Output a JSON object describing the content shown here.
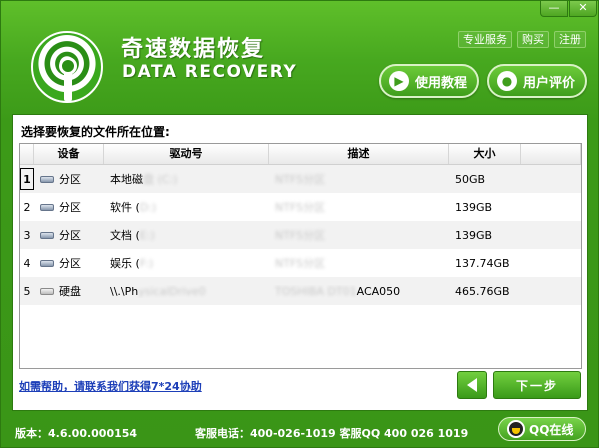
{
  "window": {
    "minimize_glyph": "—",
    "close_glyph": "✕"
  },
  "header": {
    "title_cn": "奇速数据恢复",
    "title_en": "DATA RECOVERY",
    "links": [
      "专业服务",
      "购买",
      "注册"
    ],
    "tutorial_label": "使用教程",
    "review_label": "用户评价",
    "tutorial_icon": "play-icon",
    "review_icon": "user-icon"
  },
  "panel": {
    "title": "选择要恢复的文件所在位置:",
    "columns": [
      "",
      "设备",
      "驱动号",
      "描述",
      "大小",
      ""
    ],
    "rows": [
      {
        "idx": "1",
        "device": "分区",
        "drive": "本地磁",
        "drive_hidden": "盘 (C:)",
        "desc": "",
        "desc_hidden": "NTFS分区",
        "size": "50GB",
        "icon": "partition-icon"
      },
      {
        "idx": "2",
        "device": "分区",
        "drive": "软件 (",
        "drive_hidden": "D:)",
        "desc": "",
        "desc_hidden": "NTFS分区",
        "size": "139GB",
        "icon": "partition-icon"
      },
      {
        "idx": "3",
        "device": "分区",
        "drive": "文档 (",
        "drive_hidden": "E:)",
        "desc": "",
        "desc_hidden": "NTFS分区",
        "size": "139GB",
        "icon": "partition-icon"
      },
      {
        "idx": "4",
        "device": "分区",
        "drive": "娱乐 (",
        "drive_hidden": "F:)",
        "desc": "",
        "desc_hidden": "NTFS分区",
        "size": "137.74GB",
        "icon": "partition-icon"
      },
      {
        "idx": "5",
        "device": "硬盘",
        "drive": "\\\\.\\Ph",
        "drive_hidden": "ysicalDrive0",
        "desc": "ACA050",
        "desc_hidden": "TOSHIBA DT01",
        "size": "465.76GB",
        "icon": "harddisk-icon"
      }
    ],
    "help_link": "如需帮助，请联系我们获得7*24协助",
    "next_label": "下一步"
  },
  "footer": {
    "version": "版本：4.6.00.000154",
    "contact": "客服电话：400-026-1019  客服QQ 400 026 1019",
    "qq_label": "QQ在线"
  },
  "colors": {
    "brand_green": "#47a81f",
    "link_blue": "#1d3fb8"
  }
}
